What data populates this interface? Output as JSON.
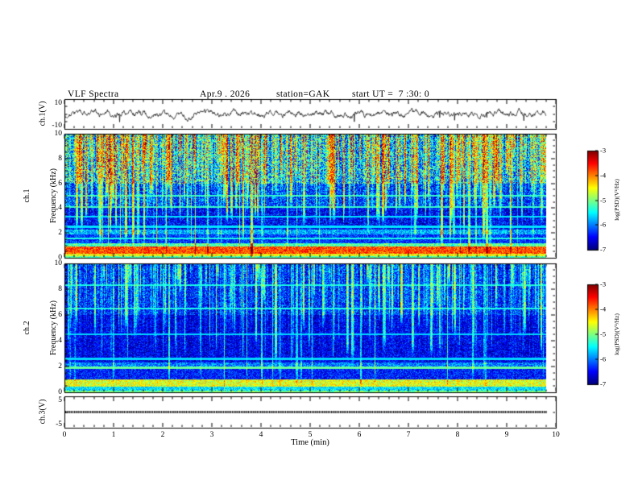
{
  "title": {
    "main": "VLF Spectra",
    "date": "Apr.9 . 2026",
    "station": "station=GAK",
    "start_ut": "start UT =  7 :30: 0"
  },
  "axes": {
    "x": {
      "label": "Time (min)",
      "min": 0,
      "max": 10,
      "major_ticks": [
        0,
        1,
        2,
        3,
        4,
        5,
        6,
        7,
        8,
        9,
        10
      ],
      "minor_step": 0.2,
      "data_end_min": 9.8
    },
    "spec_y": {
      "min": 0,
      "max": 10,
      "labeled_ticks": [
        10,
        8,
        6,
        4,
        2,
        0
      ],
      "minor_step": 0.5,
      "major_step": 2
    },
    "wave1_y": {
      "min": -10,
      "max": 10,
      "labeled_ticks": [
        10,
        -10
      ],
      "tick_values": [
        10,
        5,
        0,
        -5,
        -10
      ]
    },
    "wave3_y": {
      "min": -5,
      "max": 5,
      "labeled_ticks": [
        5,
        -5
      ],
      "tick_values": [
        5,
        0,
        -5
      ]
    }
  },
  "panels": {
    "wave1": {
      "ylabel": "ch.1(V)"
    },
    "spec1": {
      "ylabel_line1": "ch.1",
      "ylabel_line2": "Frequency (kHz)"
    },
    "spec2": {
      "ylabel_line1": "ch.2",
      "ylabel_line2": "Frequency (kHz)"
    },
    "wave3": {
      "ylabel": "ch.3(V)"
    }
  },
  "colorbar": {
    "label": "log(PSD)(V²/Hz)",
    "tick_labels": [
      -3,
      -4,
      -5,
      -6,
      -7
    ],
    "max": -3,
    "min": -7
  },
  "chart_data": [
    {
      "type": "line",
      "panel": "ch1_waveform",
      "ylabel": "ch.1(V)",
      "xlim": [
        0,
        10
      ],
      "ylim": [
        -10,
        10
      ],
      "x_data_end": 9.8,
      "summary": "Broadband noise waveform centred on 0 V, typical excursions about ±3 V, with intermittent impulsive negative spikes reaching roughly -8 V; trace ends near 9.8 min"
    },
    {
      "type": "heatmap",
      "panel": "ch1_spectrogram",
      "xlabel": "Time (min)",
      "ylabel": "Frequency (kHz)",
      "xlim": [
        0,
        10
      ],
      "ylim": [
        0,
        10
      ],
      "zlabel": "log(PSD)(V²/Hz)",
      "zlim": [
        -7,
        -3
      ],
      "colormap": "jet",
      "bands": [
        {
          "f_khz": [
            6.0,
            10.0
          ],
          "mean_log_psd": -5.7,
          "noise": 1.0
        },
        {
          "f_khz": [
            4.0,
            6.0
          ],
          "mean_log_psd": -6.2,
          "noise": 0.7
        },
        {
          "f_khz": [
            2.3,
            4.0
          ],
          "mean_log_psd": -6.5,
          "noise": 0.55
        },
        {
          "f_khz": [
            1.9,
            2.3
          ],
          "mean_log_psd": -5.8,
          "noise": 0.5
        },
        {
          "f_khz": [
            1.2,
            1.9
          ],
          "mean_log_psd": -6.3,
          "noise": 0.5
        },
        {
          "f_khz": [
            0.9,
            1.2
          ],
          "mean_log_psd": -5.2,
          "noise": 0.5
        },
        {
          "f_khz": [
            0.35,
            0.9
          ],
          "mean_log_psd": -3.8,
          "noise": 0.45
        },
        {
          "f_khz": [
            0.15,
            0.35
          ],
          "mean_log_psd": -4.5,
          "noise": 0.4
        },
        {
          "f_khz": [
            0.0,
            0.15
          ],
          "mean_log_psd": -5.2,
          "noise": 0.4
        }
      ],
      "horizontal_lines_khz": [
        1.55,
        2.5,
        3.3,
        4.1,
        5.0
      ],
      "summary": "Dense vertical broadband impulses (sferics) strongest above 6 kHz appearing green-yellow with red specks; dark blue background near -6.5 between 2 and 6 kHz with cyan speckle; intense red-orange band at 0.35-0.9 kHz near -3.8; bright yellow-green line at the bottom edge"
    },
    {
      "type": "heatmap",
      "panel": "ch2_spectrogram",
      "xlabel": "Time (min)",
      "ylabel": "Frequency (kHz)",
      "xlim": [
        0,
        10
      ],
      "ylim": [
        0,
        10
      ],
      "zlabel": "log(PSD)(V²/Hz)",
      "zlim": [
        -7,
        -3
      ],
      "colormap": "jet",
      "bands": [
        {
          "f_khz": [
            6.0,
            10.0
          ],
          "mean_log_psd": -6.3,
          "noise": 0.6
        },
        {
          "f_khz": [
            2.3,
            6.0
          ],
          "mean_log_psd": -6.55,
          "noise": 0.45
        },
        {
          "f_khz": [
            1.8,
            2.3
          ],
          "mean_log_psd": -6.0,
          "noise": 0.5
        },
        {
          "f_khz": [
            1.0,
            1.8
          ],
          "mean_log_psd": -6.4,
          "noise": 0.45
        },
        {
          "f_khz": [
            0.45,
            1.0
          ],
          "mean_log_psd": -4.6,
          "noise": 0.5
        },
        {
          "f_khz": [
            0.15,
            0.45
          ],
          "mean_log_psd": -5.6,
          "noise": 0.4
        },
        {
          "f_khz": [
            0.0,
            0.15
          ],
          "mean_log_psd": -5.0,
          "noise": 0.4
        }
      ],
      "horizontal_lines_khz": [
        1.9,
        2.6,
        4.5,
        6.5,
        8.3
      ],
      "summary": "Mostly dark blue (near -6.5) with scattered cyan-green vertical impulses over the full band; cyan band near 2 kHz; weaker yellow-orange band at 0.45-1 kHz; green line at the bottom edge"
    },
    {
      "type": "line",
      "panel": "ch3_waveform",
      "ylabel": "ch.3(V)",
      "xlim": [
        0,
        10
      ],
      "ylim": [
        -5,
        5
      ],
      "x_data_end": 9.8,
      "summary": "Constant flat trace at 0 V drawn as a thick dotted black line"
    }
  ],
  "render": {
    "colormap": "jet",
    "spec1": {
      "seed": 1234,
      "streak_count": 300,
      "streak_amp": [
        0.5,
        1.8
      ],
      "streak_reach_khz": [
        2,
        9
      ],
      "full_streak_prob": 0.18,
      "column_noise": 0.55
    },
    "spec2": {
      "seed": 777,
      "streak_count": 210,
      "streak_amp": [
        0.4,
        1.4
      ],
      "streak_reach_khz": [
        1.5,
        8
      ],
      "full_streak_prob": 0.12,
      "column_noise": 0.4
    },
    "wave1": {
      "seed": 99,
      "smooth": 0.86,
      "noise_amp": 1.15,
      "spike_prob": 0.006,
      "spike_amp": [
        3,
        6
      ]
    }
  }
}
